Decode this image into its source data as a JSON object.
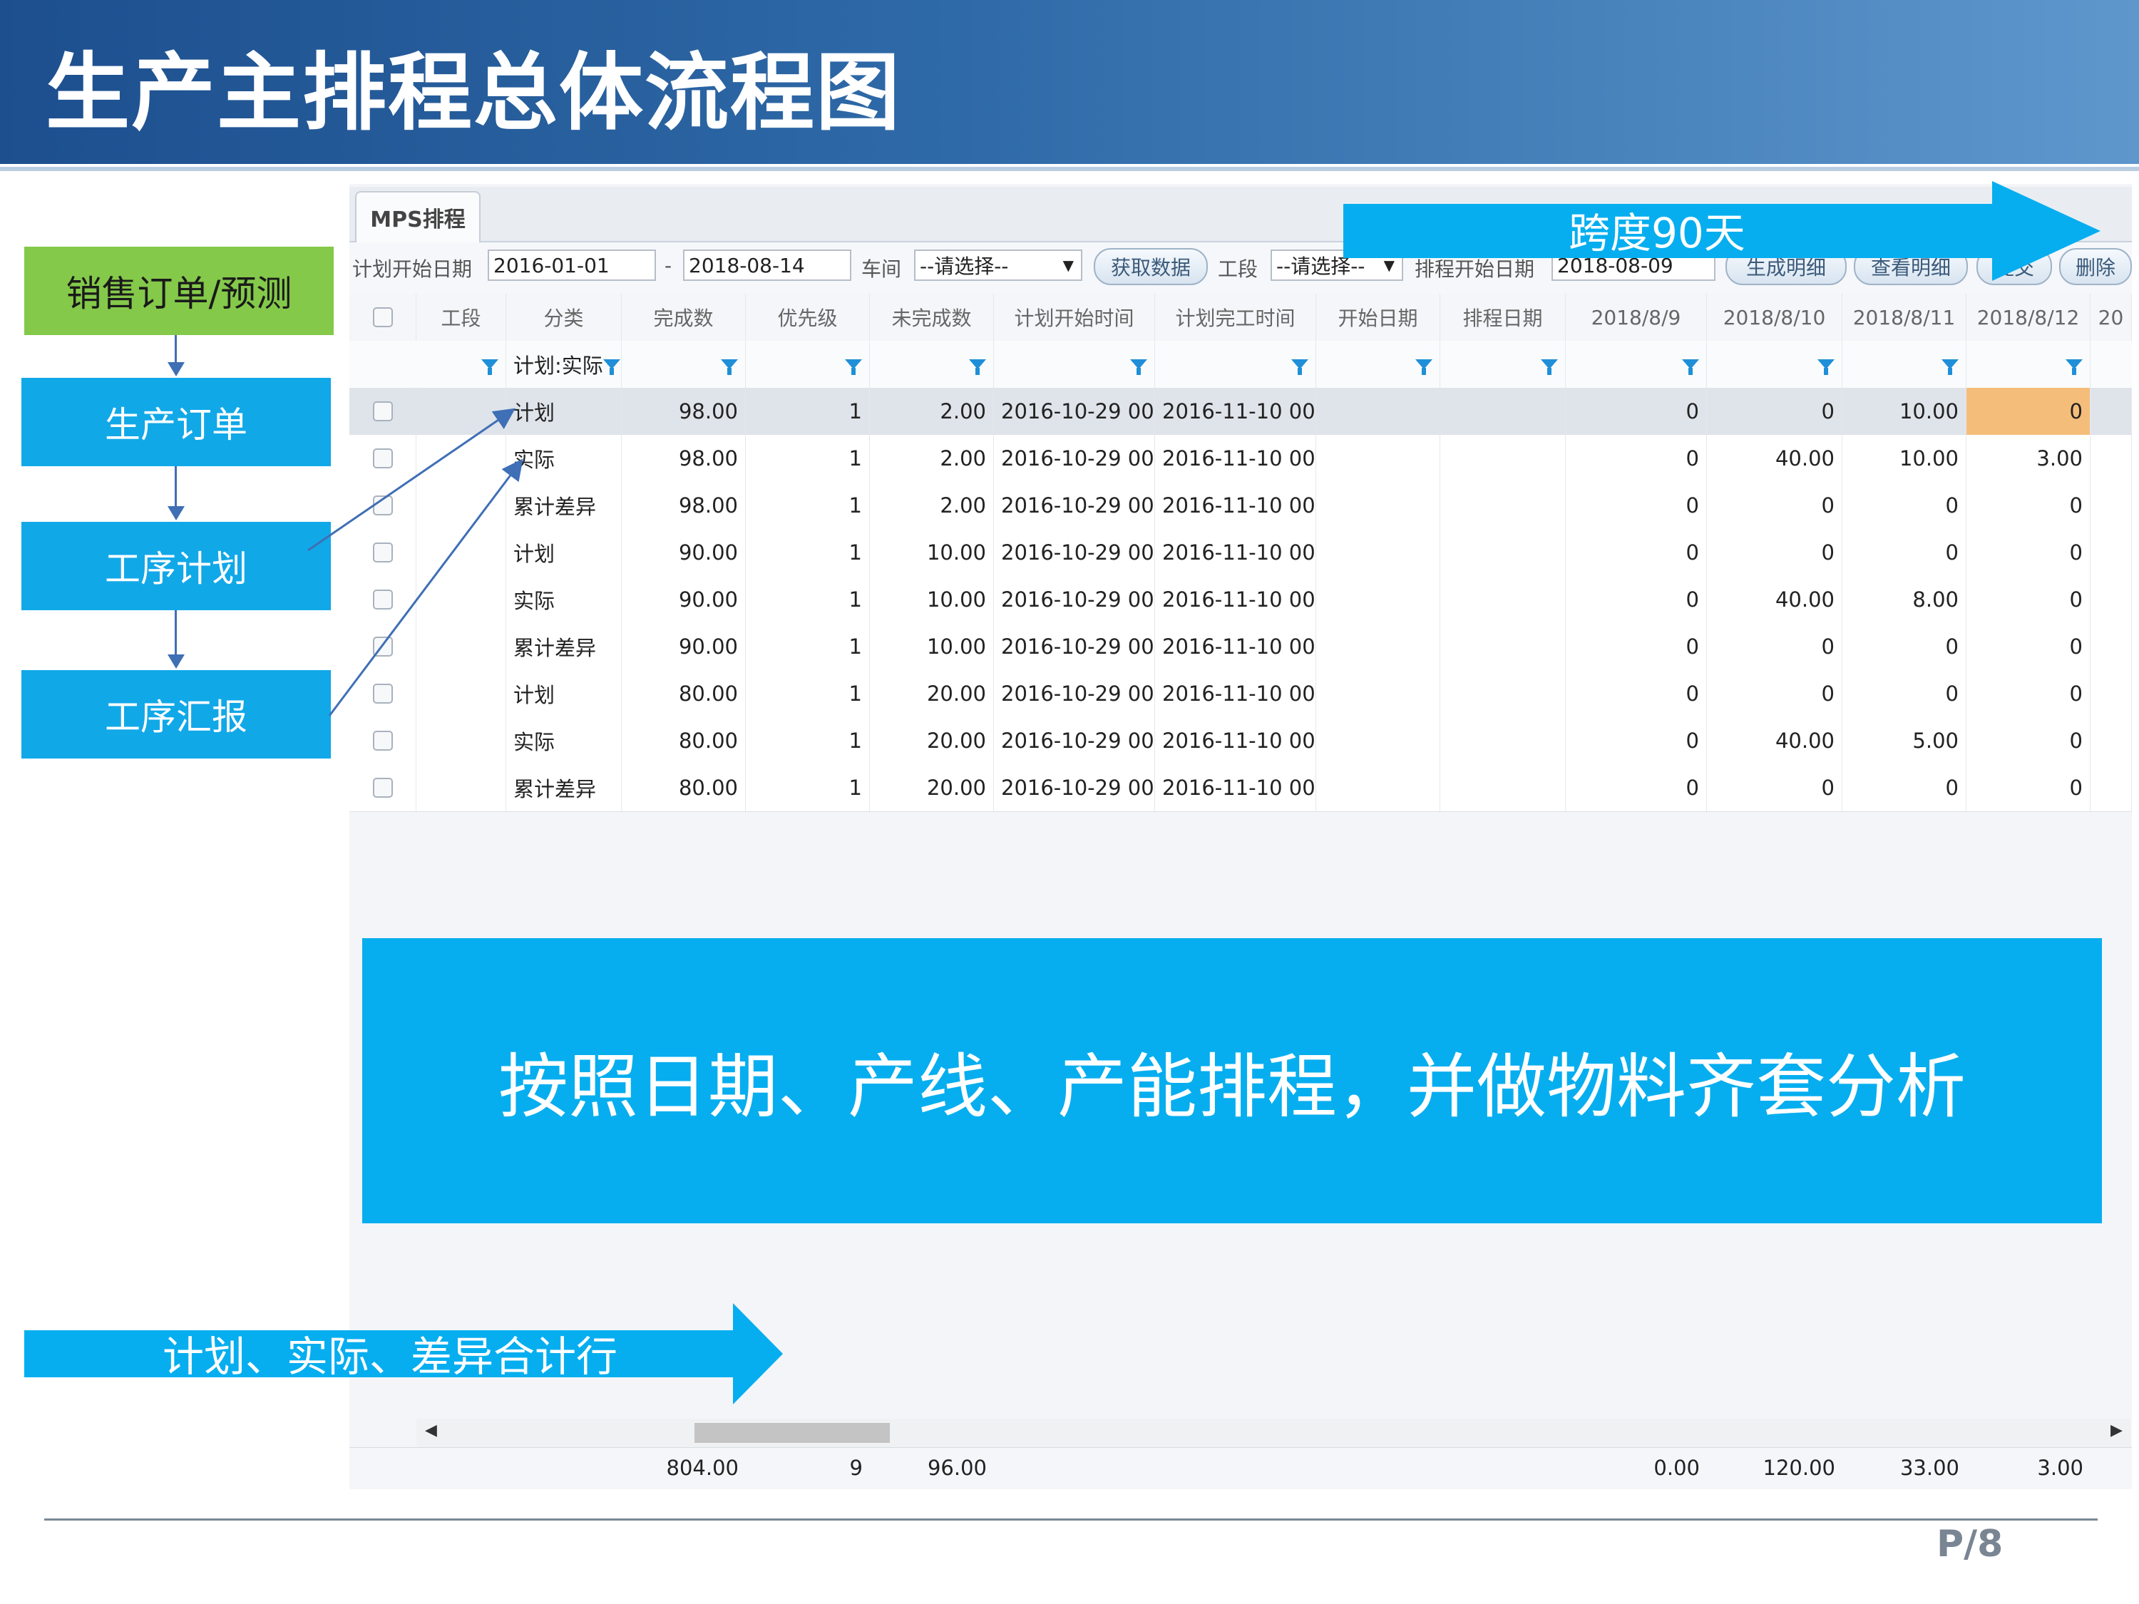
{
  "title": "生产主排程总体流程图",
  "flow": [
    "销售订单/预测",
    "生产订单",
    "工序计划",
    "工序汇报"
  ],
  "colors": {
    "header": "#1d4f8e",
    "flow_blue": "#11a8e8",
    "flow_green": "#84c94a",
    "banner": "#06aeef"
  },
  "app": {
    "tab": "MPS排程",
    "filters": {
      "plan_start_label": "计划开始日期",
      "date_from": "2016-01-01",
      "dash": "-",
      "date_to": "2018-08-14",
      "workshop_label": "车间",
      "workshop_value": "--请选择--",
      "fetch_button": "获取数据",
      "section_label": "工段",
      "section_value": "--请选择--",
      "schedule_start_label": "排程开始日期",
      "schedule_start_value": "2018-08-09",
      "buttons": [
        "生成明细",
        "查看明细",
        "提交",
        "删除"
      ]
    },
    "columns": [
      "工段",
      "分类",
      "完成数",
      "优先级",
      "未完成数",
      "计划开始时间",
      "计划完工时间",
      "开始日期",
      "排程日期",
      "2018/8/9",
      "2018/8/10",
      "2018/8/11",
      "2018/8/12",
      "20"
    ],
    "filter_category": "计划:实际",
    "rows": [
      {
        "cat": "计划",
        "done": "98.00",
        "pri": "1",
        "undone": "2.00",
        "start": "2016-10-29 00",
        "end": "2016-11-10 00",
        "d9": "0",
        "d10": "0",
        "d11": "10.00",
        "d12": "0"
      },
      {
        "cat": "实际",
        "done": "98.00",
        "pri": "1",
        "undone": "2.00",
        "start": "2016-10-29 00",
        "end": "2016-11-10 00",
        "d9": "0",
        "d10": "40.00",
        "d11": "10.00",
        "d12": "3.00"
      },
      {
        "cat": "累计差异",
        "done": "98.00",
        "pri": "1",
        "undone": "2.00",
        "start": "2016-10-29 00",
        "end": "2016-11-10 00",
        "d9": "0",
        "d10": "0",
        "d11": "0",
        "d12": "0"
      },
      {
        "cat": "计划",
        "done": "90.00",
        "pri": "1",
        "undone": "10.00",
        "start": "2016-10-29 00",
        "end": "2016-11-10 00",
        "d9": "0",
        "d10": "0",
        "d11": "0",
        "d12": "0"
      },
      {
        "cat": "实际",
        "done": "90.00",
        "pri": "1",
        "undone": "10.00",
        "start": "2016-10-29 00",
        "end": "2016-11-10 00",
        "d9": "0",
        "d10": "40.00",
        "d11": "8.00",
        "d12": "0"
      },
      {
        "cat": "累计差异",
        "done": "90.00",
        "pri": "1",
        "undone": "10.00",
        "start": "2016-10-29 00",
        "end": "2016-11-10 00",
        "d9": "0",
        "d10": "0",
        "d11": "0",
        "d12": "0"
      },
      {
        "cat": "计划",
        "done": "80.00",
        "pri": "1",
        "undone": "20.00",
        "start": "2016-10-29 00",
        "end": "2016-11-10 00",
        "d9": "0",
        "d10": "0",
        "d11": "0",
        "d12": "0"
      },
      {
        "cat": "实际",
        "done": "80.00",
        "pri": "1",
        "undone": "20.00",
        "start": "2016-10-29 00",
        "end": "2016-11-10 00",
        "d9": "0",
        "d10": "40.00",
        "d11": "5.00",
        "d12": "0"
      },
      {
        "cat": "累计差异",
        "done": "80.00",
        "pri": "1",
        "undone": "20.00",
        "start": "2016-10-29 00",
        "end": "2016-11-10 00",
        "d9": "0",
        "d10": "0",
        "d11": "0",
        "d12": "0"
      }
    ],
    "totals": {
      "done": "804.00",
      "pri": "9",
      "undone": "96.00",
      "d9": "0.00",
      "d10": "120.00",
      "d11": "33.00",
      "d12": "3.00"
    }
  },
  "span_label": "跨度90天",
  "summary": "按照日期、产线、产能排程，并做物料齐套分析",
  "merge_label": "计划、实际、差异合计行",
  "page": "P/8"
}
